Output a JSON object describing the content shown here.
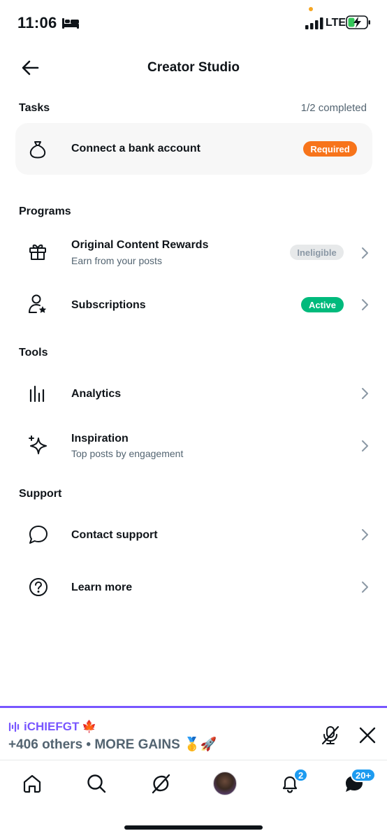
{
  "status_bar": {
    "time": "11:06",
    "network": "LTE",
    "icons": [
      "bed-icon",
      "signal-icon",
      "battery-charging-icon"
    ]
  },
  "header": {
    "title": "Creator Studio",
    "back_icon": "arrow-left-icon"
  },
  "tasks": {
    "title": "Tasks",
    "status": "1/2 completed",
    "items": [
      {
        "label": "Connect a bank account",
        "badge": "Required",
        "icon": "money-bag-icon",
        "badge_color": "#f7741b"
      }
    ]
  },
  "programs": {
    "title": "Programs",
    "items": [
      {
        "label": "Original Content Rewards",
        "sublabel": "Earn from your posts",
        "badge": "Ineligible",
        "icon": "gift-icon"
      },
      {
        "label": "Subscriptions",
        "badge": "Active",
        "icon": "person-star-icon",
        "badge_color": "#00ba7c"
      }
    ]
  },
  "tools": {
    "title": "Tools",
    "items": [
      {
        "label": "Analytics",
        "icon": "bar-chart-icon"
      },
      {
        "label": "Inspiration",
        "sublabel": "Top posts by engagement",
        "icon": "sparkle-icon"
      }
    ]
  },
  "support": {
    "title": "Support",
    "items": [
      {
        "label": "Contact support",
        "icon": "chat-bubble-icon"
      },
      {
        "label": "Learn more",
        "icon": "help-circle-icon"
      }
    ]
  },
  "spaces_bar": {
    "host": "iCHIEFGT",
    "host_emoji": "🍁",
    "subtitle": "+406 others • MORE GAINS 🥇🚀",
    "accent": "#7856ff"
  },
  "bottom_nav": {
    "items": [
      "home-icon",
      "search-icon",
      "grok-icon",
      "avatar",
      "notifications-icon",
      "messages-icon"
    ],
    "notifications_count": "2",
    "messages_count": "20+"
  }
}
